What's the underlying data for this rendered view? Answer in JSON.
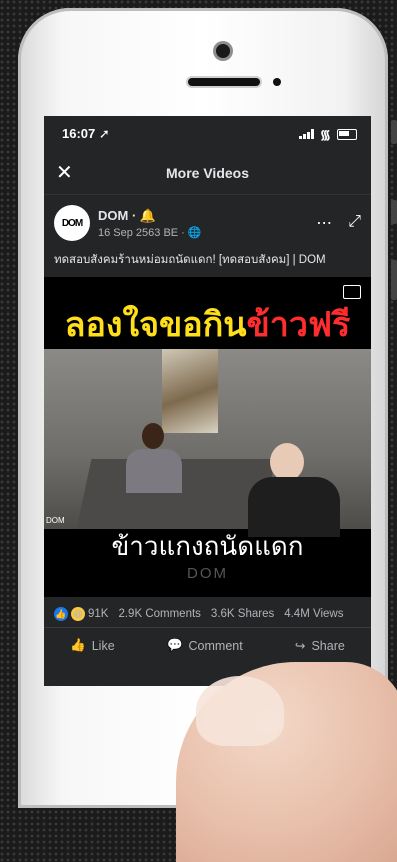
{
  "statusbar": {
    "time": "16:07 ➚"
  },
  "header": {
    "close_glyph": "✕",
    "title": "More Videos"
  },
  "post": {
    "avatar_text": "DOM",
    "author": "DOM · 🔔",
    "date": "16 Sep 2563 BE · 🌐",
    "caption": "ทดสอบสังคมร้านหม่อมถนัดแดก! [ทดสอบสังคม] | DOM"
  },
  "video": {
    "banner_yellow": "ลองใจขอกิน",
    "banner_red": "ข้าวฟรี",
    "subtitle": "ข้าวแกงถนัดแดก",
    "watermark": "DOM",
    "corner_label": "DOM"
  },
  "stats": {
    "reactions_count": "91K",
    "comments": "2.9K Comments",
    "shares": "3.6K Shares",
    "views": "4.4M Views"
  },
  "actions": {
    "like": "Like",
    "comment": "Comment",
    "share": "Share"
  },
  "icons": {
    "like_icon": "👍",
    "comment_icon": "💬",
    "share_icon": "↪",
    "more_icon": "⋯",
    "expand_icon": "⤢"
  },
  "colors": {
    "screen_bg": "#242526",
    "banner_yellow": "#ffde1a",
    "banner_red": "#ff2d2d",
    "like_blue": "#1877f2"
  }
}
